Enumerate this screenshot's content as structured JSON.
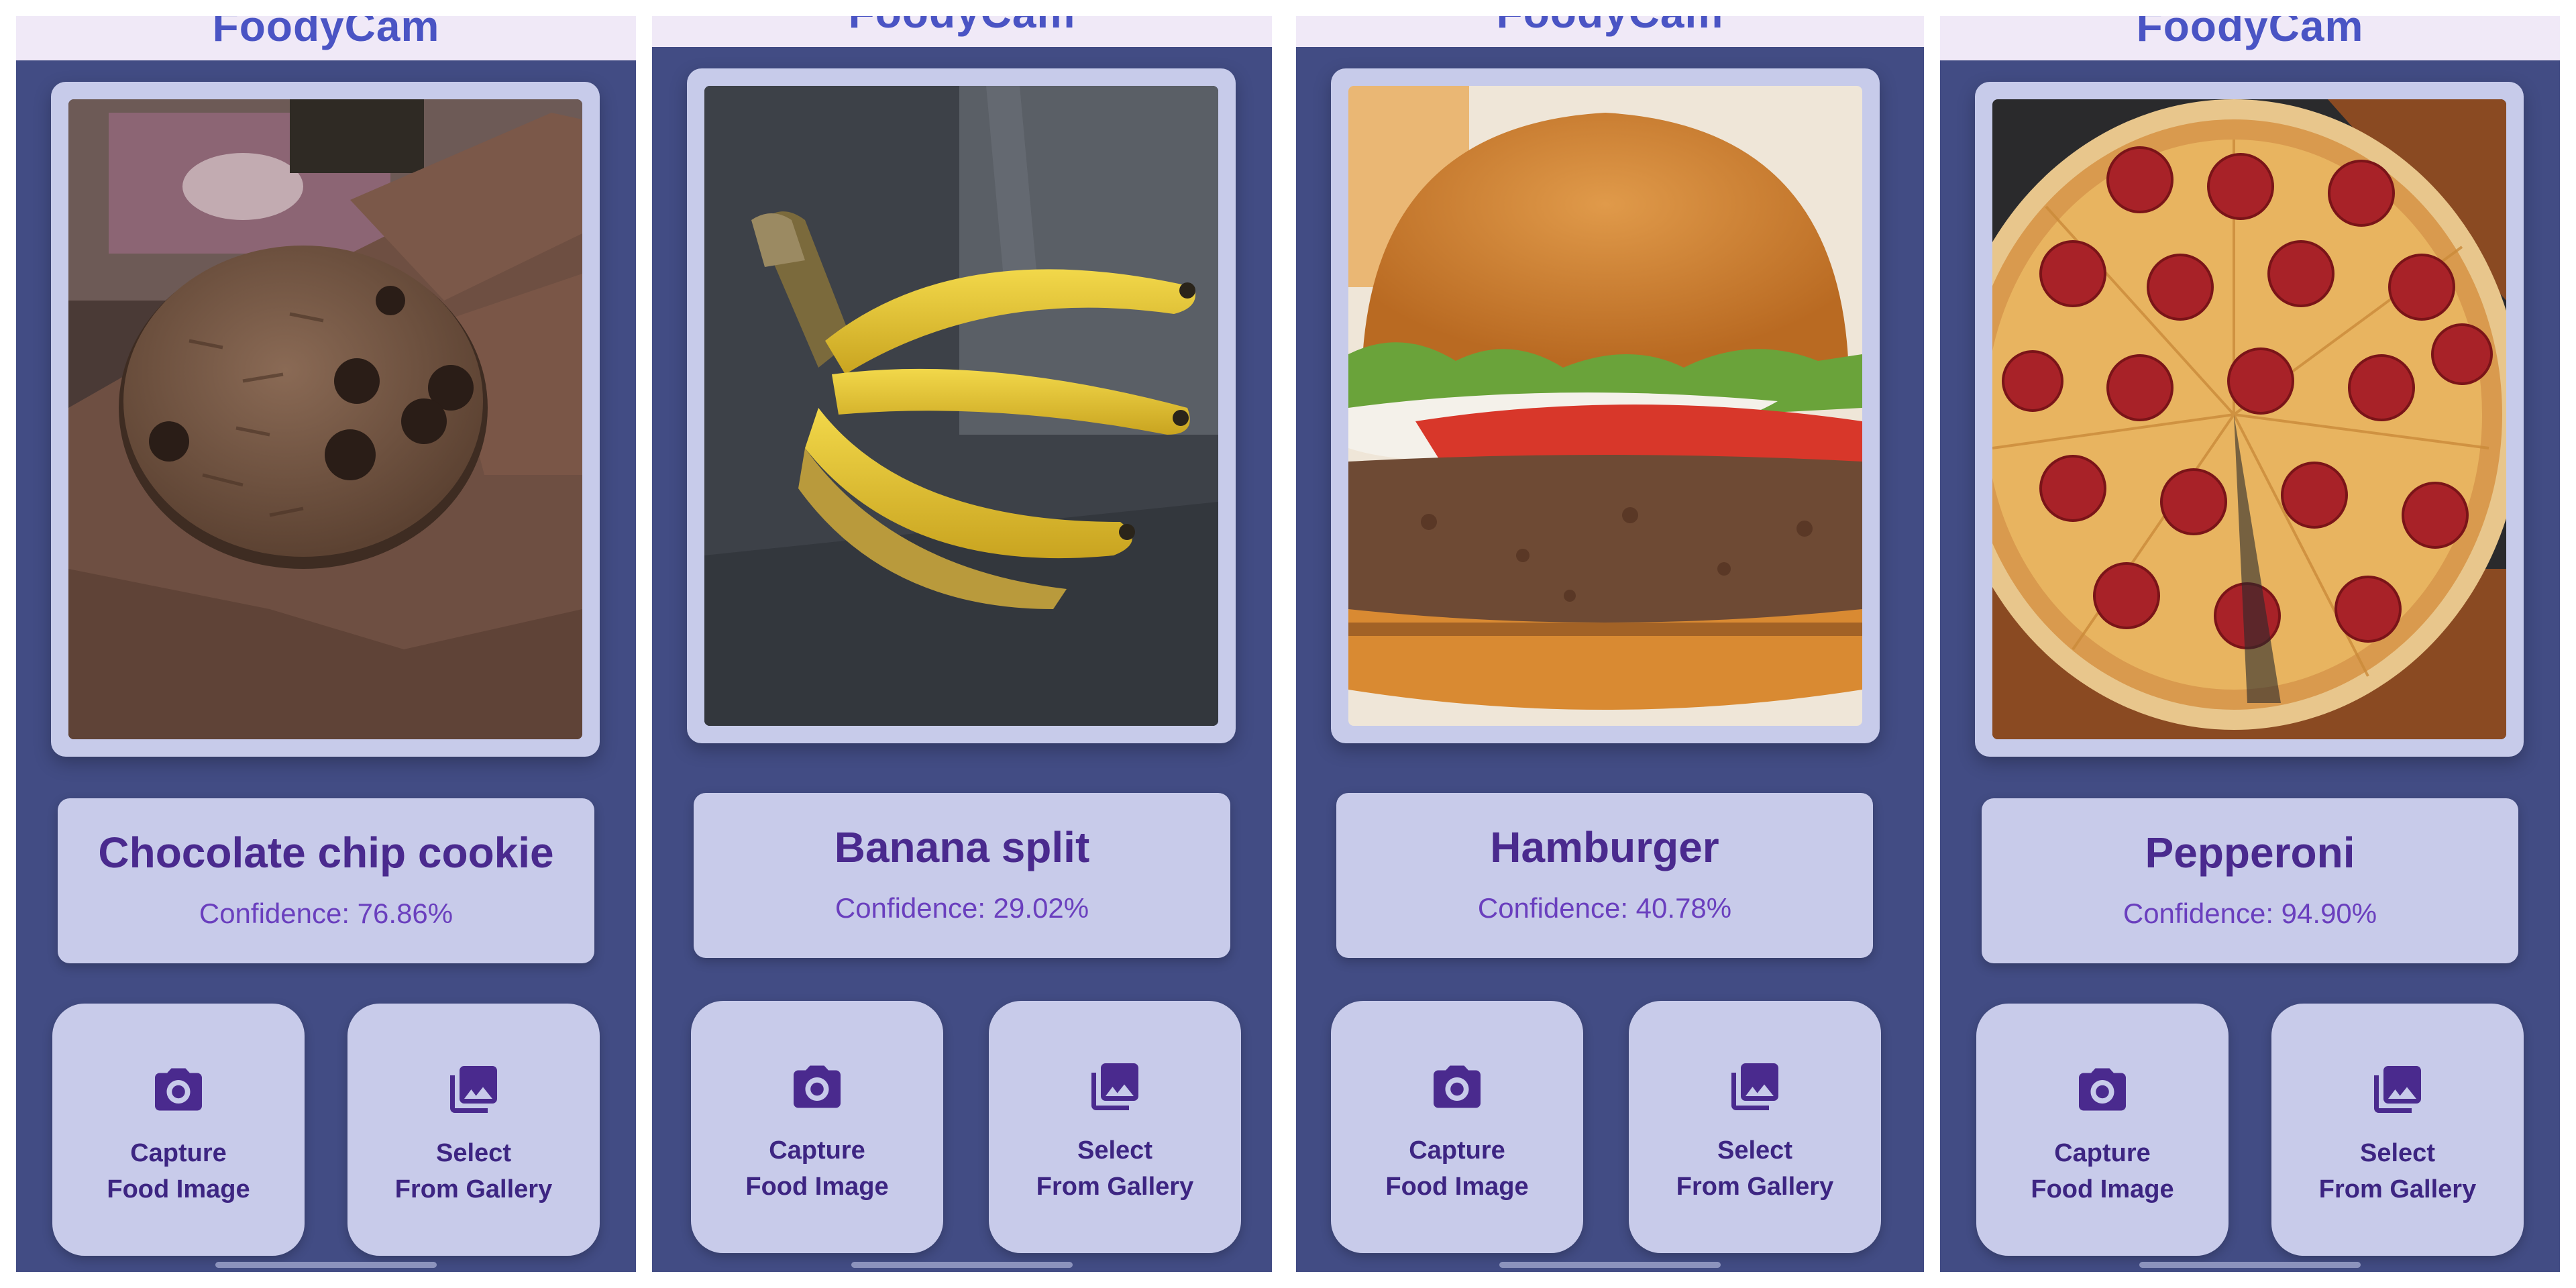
{
  "app": {
    "title": "FoodyCam"
  },
  "colors": {
    "background": "#424c84",
    "appbar": "#f0e9f7",
    "card": "#c8cbea",
    "title_text": "#4a2a8e",
    "confidence_text": "#6a3fbe",
    "icon": "#4a2a8e"
  },
  "screens": [
    {
      "photo_subject": "chocolate-chip-cookie",
      "result": {
        "food_name": "Chocolate chip cookie",
        "confidence": "Confidence: 76.86%"
      },
      "capture_button": {
        "icon": "camera-icon",
        "line1": "Capture",
        "line2": "Food Image"
      },
      "gallery_button": {
        "icon": "gallery-icon",
        "line1": "Select",
        "line2": "From Gallery"
      }
    },
    {
      "photo_subject": "bananas",
      "result": {
        "food_name": "Banana split",
        "confidence": "Confidence: 29.02%"
      },
      "capture_button": {
        "icon": "camera-icon",
        "line1": "Capture",
        "line2": "Food Image"
      },
      "gallery_button": {
        "icon": "gallery-icon",
        "line1": "Select",
        "line2": "From Gallery"
      }
    },
    {
      "photo_subject": "hamburger",
      "result": {
        "food_name": "Hamburger",
        "confidence": "Confidence: 40.78%"
      },
      "capture_button": {
        "icon": "camera-icon",
        "line1": "Capture",
        "line2": "Food Image"
      },
      "gallery_button": {
        "icon": "gallery-icon",
        "line1": "Select",
        "line2": "From Gallery"
      }
    },
    {
      "photo_subject": "pepperoni-pizza",
      "result": {
        "food_name": "Pepperoni",
        "confidence": "Confidence: 94.90%"
      },
      "capture_button": {
        "icon": "camera-icon",
        "line1": "Capture",
        "line2": "Food Image"
      },
      "gallery_button": {
        "icon": "gallery-icon",
        "line1": "Select",
        "line2": "From Gallery"
      }
    }
  ]
}
